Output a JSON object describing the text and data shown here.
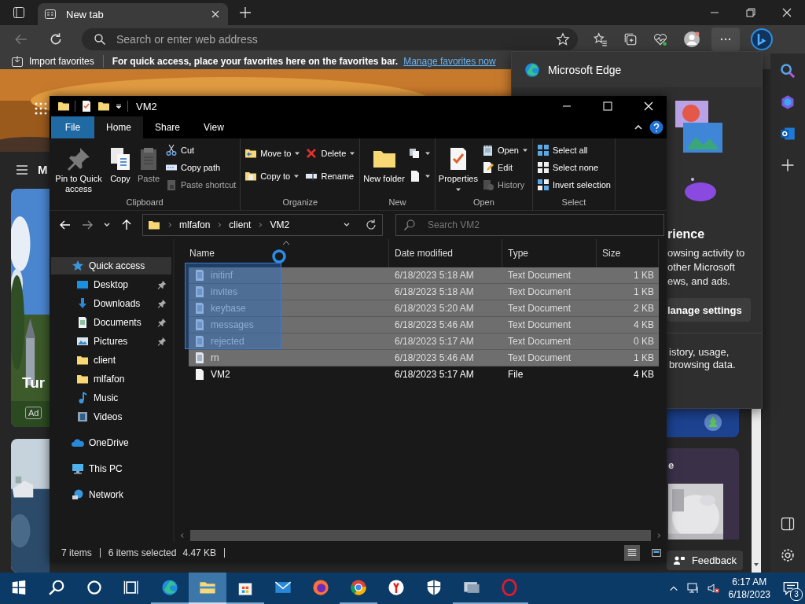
{
  "browser": {
    "tabs": [
      {
        "label": "New tab",
        "selected": true
      }
    ],
    "address": {
      "placeholder": "Search or enter web address"
    },
    "favorites_bar": {
      "import_label": "Import favorites",
      "hint": "For quick access, place your favorites here on the favorites bar.",
      "link": "Manage favorites now"
    }
  },
  "page": {
    "menu_letter": "M",
    "card_title": "Tur",
    "ad_label": "Ad",
    "card_2_title": "e",
    "feedback": "Feedback"
  },
  "edge_panel": {
    "title": "Microsoft Edge",
    "heading": "rience",
    "paragraph": [
      "owsing activity to",
      "other Microsoft",
      "ews, and ads."
    ],
    "button": "lanage settings",
    "paragraph_2": [
      "istory, usage,",
      "browsing data."
    ]
  },
  "explorer": {
    "title": "VM2",
    "ribbon_tabs": [
      {
        "label": "File",
        "kind": "file",
        "selected": false
      },
      {
        "label": "Home",
        "kind": "tab",
        "selected": true
      },
      {
        "label": "Share",
        "kind": "tab",
        "selected": false
      },
      {
        "label": "View",
        "kind": "tab",
        "selected": false
      }
    ],
    "ribbon_groups": [
      {
        "label": "Clipboard",
        "columns": [
          [
            {
              "kind": "pin",
              "label": "Pin to Quick access",
              "large": true,
              "dropdown": false,
              "disabled": false
            }
          ],
          [
            {
              "kind": "copy",
              "label": "Copy",
              "large": true,
              "dropdown": false,
              "disabled": false
            }
          ],
          [
            {
              "kind": "paste",
              "label": "Paste",
              "large": true,
              "dropdown": false,
              "disabled": true
            }
          ],
          [
            {
              "kind": "cut",
              "label": "Cut",
              "large": false,
              "dropdown": false,
              "disabled": false
            },
            {
              "kind": "copy-path",
              "label": "Copy path",
              "large": false,
              "dropdown": false,
              "disabled": false
            },
            {
              "kind": "paste-shortcut",
              "label": "Paste shortcut",
              "large": false,
              "dropdown": false,
              "disabled": true
            }
          ]
        ]
      },
      {
        "label": "Organize",
        "columns": [
          [
            {
              "kind": "move-to",
              "label": "Move to",
              "large": false,
              "dropdown": true,
              "disabled": false
            },
            {
              "kind": "copy-to",
              "label": "Copy to",
              "large": false,
              "dropdown": true,
              "disabled": false
            }
          ],
          [
            {
              "kind": "delete",
              "label": "Delete",
              "large": false,
              "dropdown": true,
              "disabled": false
            },
            {
              "kind": "rename",
              "label": "Rename",
              "large": false,
              "dropdown": false,
              "disabled": false
            }
          ]
        ]
      },
      {
        "label": "New",
        "columns": [
          [
            {
              "kind": "new-folder",
              "label": "New folder",
              "large": true,
              "dropdown": false,
              "disabled": false
            }
          ],
          [
            {
              "kind": "new-item",
              "large": false,
              "dropdown": true,
              "disabled": false
            },
            {
              "kind": "easy-access",
              "large": false,
              "dropdown": true,
              "disabled": false
            }
          ]
        ]
      },
      {
        "label": "Open",
        "columns": [
          [
            {
              "kind": "properties",
              "label": "Properties",
              "large": true,
              "dropdown": true,
              "disabled": false
            }
          ],
          [
            {
              "kind": "open",
              "label": "Open",
              "large": false,
              "dropdown": true,
              "disabled": false
            },
            {
              "kind": "edit",
              "label": "Edit",
              "large": false,
              "dropdown": false,
              "disabled": false
            },
            {
              "kind": "history",
              "label": "History",
              "large": false,
              "dropdown": false,
              "disabled": true
            }
          ]
        ]
      },
      {
        "label": "Select",
        "columns": [
          [
            {
              "kind": "select-all",
              "label": "Select all",
              "large": false,
              "dropdown": false,
              "disabled": false
            },
            {
              "kind": "select-none",
              "label": "Select none",
              "large": false,
              "dropdown": false,
              "disabled": false
            },
            {
              "kind": "invert",
              "label": "Invert selection",
              "large": false,
              "dropdown": false,
              "disabled": false
            }
          ]
        ]
      }
    ],
    "breadcrumb": [
      "mlfafon",
      "client",
      "VM2"
    ],
    "search": {
      "placeholder": "Search VM2"
    },
    "nav": [
      {
        "label": "Quick access",
        "kind": "quick-access",
        "selected": true,
        "children": [
          {
            "label": "Desktop",
            "kind": "desktop",
            "pinned": true,
            "selected": false
          },
          {
            "label": "Downloads",
            "kind": "downloads",
            "pinned": true,
            "selected": false
          },
          {
            "label": "Documents",
            "kind": "documents",
            "pinned": true,
            "selected": false
          },
          {
            "label": "Pictures",
            "kind": "pictures",
            "pinned": true,
            "selected": false
          },
          {
            "label": "client",
            "kind": "folder",
            "pinned": false,
            "selected": false
          },
          {
            "label": "mlfafon",
            "kind": "folder",
            "pinned": false,
            "selected": false
          },
          {
            "label": "Music",
            "kind": "music",
            "pinned": false,
            "selected": false
          },
          {
            "label": "Videos",
            "kind": "videos",
            "pinned": false,
            "selected": false
          }
        ]
      },
      {
        "label": "OneDrive",
        "kind": "onedrive",
        "selected": false
      },
      {
        "label": "This PC",
        "kind": "pc",
        "selected": false
      },
      {
        "label": "Network",
        "kind": "network",
        "selected": false
      }
    ],
    "columns": [
      "Name",
      "Date modified",
      "Type",
      "Size"
    ],
    "files": [
      {
        "name": "initinf",
        "date": "6/18/2023 5:18 AM",
        "type": "Text Document",
        "size": "1 KB",
        "kind": "text",
        "selected": true
      },
      {
        "name": "invites",
        "date": "6/18/2023 5:18 AM",
        "type": "Text Document",
        "size": "1 KB",
        "kind": "text",
        "selected": true
      },
      {
        "name": "keybase",
        "date": "6/18/2023 5:20 AM",
        "type": "Text Document",
        "size": "2 KB",
        "kind": "text",
        "selected": true
      },
      {
        "name": "messages",
        "date": "6/18/2023 5:46 AM",
        "type": "Text Document",
        "size": "4 KB",
        "kind": "text",
        "selected": true
      },
      {
        "name": "rejected",
        "date": "6/18/2023 5:17 AM",
        "type": "Text Document",
        "size": "0 KB",
        "kind": "text",
        "selected": true
      },
      {
        "name": "rn",
        "date": "6/18/2023 5:46 AM",
        "type": "Text Document",
        "size": "1 KB",
        "kind": "text",
        "selected": true
      },
      {
        "name": "VM2",
        "date": "6/18/2023 5:17 AM",
        "type": "File",
        "size": "4 KB",
        "kind": "file",
        "selected": false
      }
    ],
    "status": {
      "item_count": "7 items",
      "selection": "6 items selected",
      "size": "4.47 KB"
    },
    "view_buttons": [
      {
        "kind": "details",
        "selected": true
      },
      {
        "kind": "tiles",
        "selected": false
      }
    ]
  },
  "taskbar": {
    "apps": [
      {
        "kind": "start",
        "running": false,
        "selected": false
      },
      {
        "kind": "search",
        "running": false,
        "selected": false
      },
      {
        "kind": "cortana",
        "running": false,
        "selected": false
      },
      {
        "kind": "taskview",
        "running": false,
        "selected": false
      },
      {
        "kind": "edge",
        "running": true,
        "selected": false
      },
      {
        "kind": "explorer",
        "running": true,
        "selected": true
      },
      {
        "kind": "store",
        "running": true,
        "selected": false
      },
      {
        "kind": "mail",
        "running": false,
        "selected": false
      },
      {
        "kind": "firefox",
        "running": false,
        "selected": false
      },
      {
        "kind": "chrome",
        "running": true,
        "selected": false
      },
      {
        "kind": "yandex",
        "running": false,
        "selected": false
      },
      {
        "kind": "defender",
        "running": false,
        "selected": false
      },
      {
        "kind": "remote",
        "running": true,
        "selected": false
      },
      {
        "kind": "opera",
        "running": true,
        "selected": false
      }
    ],
    "time": "6:17 AM",
    "date": "6/18/2023",
    "notification_count": "3"
  }
}
